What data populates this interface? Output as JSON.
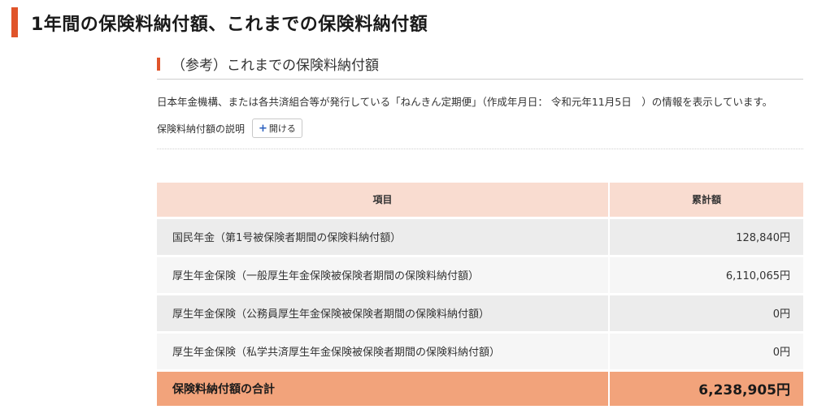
{
  "page": {
    "title": "1年間の保険料納付額、これまでの保険料納付額"
  },
  "section": {
    "title": "（参考）これまでの保険料納付額",
    "description": "日本年金機構、または各共済組合等が発行している「ねんきん定期便」（作成年月日： 令和元年11月5日　）の情報を表示しています。",
    "explain_label": "保険料納付額の説明",
    "open_button_label": "開ける",
    "open_button_icon": "plus-icon"
  },
  "table": {
    "headers": {
      "item": "項目",
      "total": "累計額"
    },
    "rows": [
      {
        "label": "国民年金（第1号被保険者期間の保険料納付額）",
        "value": "128,840円"
      },
      {
        "label": "厚生年金保険（一般厚生年金保険被保険者期間の保険料納付額）",
        "value": "6,110,065円"
      },
      {
        "label": "厚生年金保険（公務員厚生年金保険被保険者期間の保険料納付額）",
        "value": "0円"
      },
      {
        "label": "厚生年金保険（私学共済厚生年金保険被保険者期間の保険料納付額）",
        "value": "0円"
      }
    ],
    "total": {
      "label": "保険料納付額の合計",
      "value": "6,238,905円"
    }
  },
  "colors": {
    "accent": "#e0542a",
    "header_row": "#f9dcd0",
    "total_row": "#f2a37b",
    "link_blue": "#2a5fbf"
  }
}
